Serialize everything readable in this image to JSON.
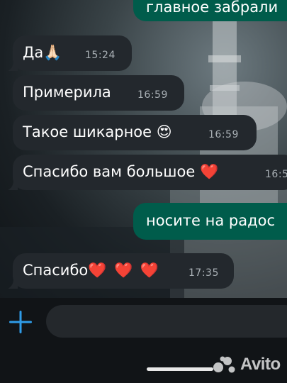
{
  "messages": [
    {
      "direction": "out",
      "text": "главное забрали",
      "time": ""
    },
    {
      "direction": "in",
      "text": "Да🙏🏻",
      "time": "15:24"
    },
    {
      "direction": "in",
      "text": "Примерила",
      "time": "16:59"
    },
    {
      "direction": "in",
      "text": "Такое шикарное 😍",
      "time": "16:59"
    },
    {
      "direction": "in",
      "text": "Спасибо вам большое",
      "emoji": "❤️",
      "time": "16:5"
    },
    {
      "direction": "out",
      "text": "носите на радос",
      "time": ""
    },
    {
      "direction": "in",
      "text": "Спасибо",
      "emoji": "❤️ ❤️ ❤️",
      "time": "17:35"
    }
  ],
  "composer": {
    "add_icon": "plus-icon",
    "input_value": ""
  },
  "watermark": {
    "text": "Avito"
  },
  "colors": {
    "incoming_bubble": "#23282d",
    "outgoing_bubble": "#005c4b",
    "accent": "#2f9ce8",
    "heart": "#e5172f"
  }
}
